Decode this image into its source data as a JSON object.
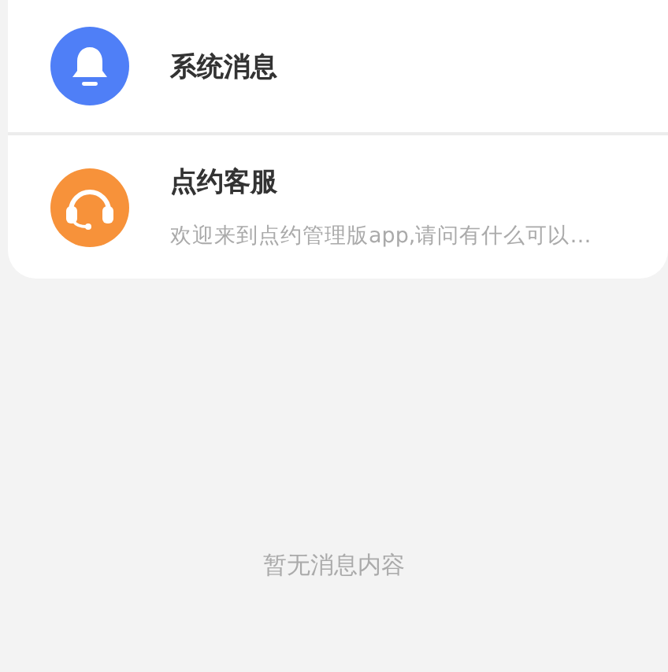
{
  "messages": [
    {
      "kind": "bell",
      "title": "系统消息",
      "color": "#4f7ff7"
    },
    {
      "kind": "headset",
      "title": "点约客服",
      "preview": "欢迎来到点约管理版app,请问有什么可以…",
      "color": "#f7923a"
    }
  ],
  "empty_text": "暂无消息内容"
}
